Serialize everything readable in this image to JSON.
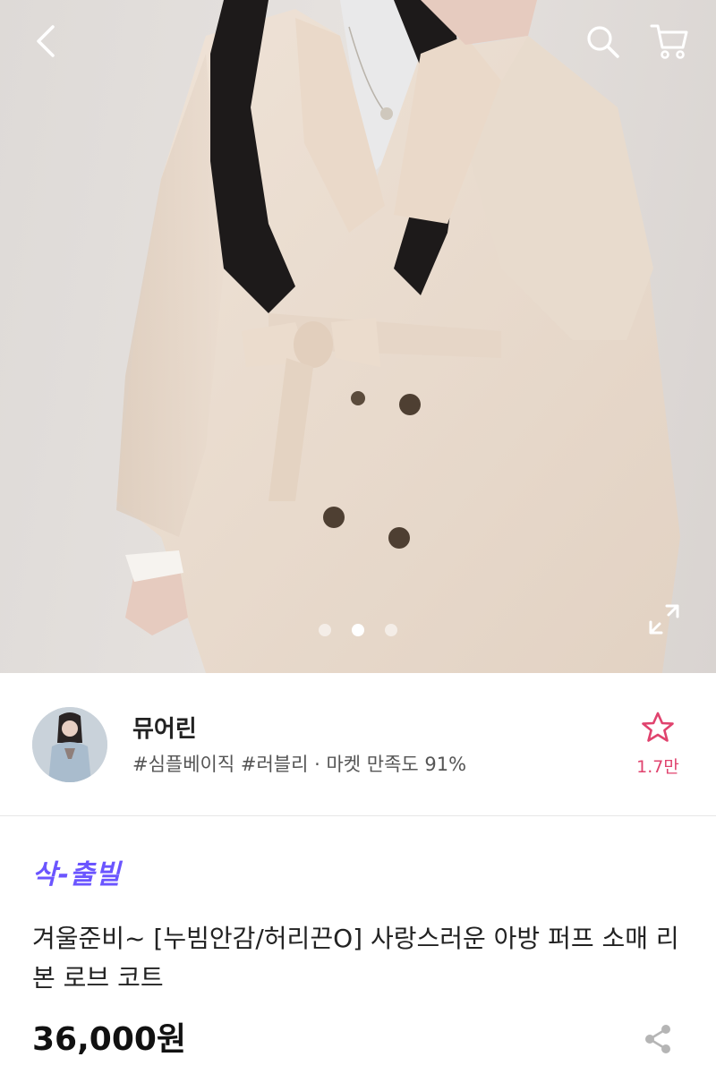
{
  "header": {
    "back_icon": "chevron-left-icon",
    "search_icon": "search-icon",
    "cart_icon": "cart-icon"
  },
  "gallery": {
    "total_images": 3,
    "active_index": 1,
    "expand_icon": "expand-icon"
  },
  "seller": {
    "name": "뮤어린",
    "meta": "#심플베이직 #러블리 · 마켓 만족도 91%",
    "favorite_count": "1.7만",
    "favorite_icon": "star-outline-icon"
  },
  "product": {
    "delivery_tag": "삭-출빌",
    "title": "겨울준비~ [누빔안감/허리끈O] 사랑스러운 아방 퍼프 소매 리본 로브 코트",
    "price": "36,000원",
    "share_icon": "share-icon"
  },
  "colors": {
    "accent_purple": "#6b55ff",
    "favorite_pink": "#e0436e"
  }
}
